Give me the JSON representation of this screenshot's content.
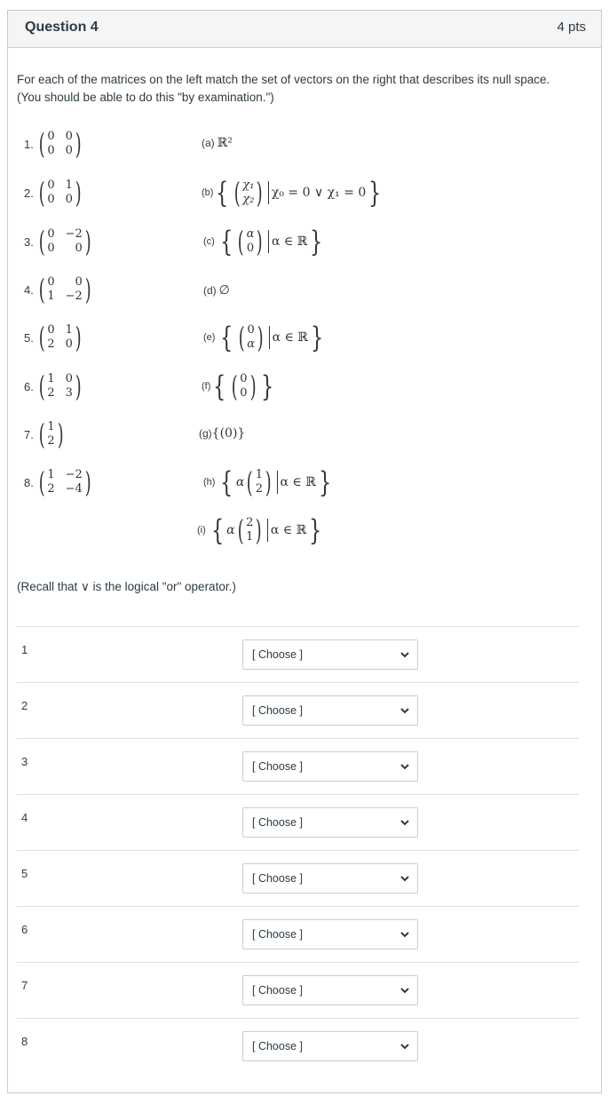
{
  "question": {
    "title": "Question 4",
    "points": "4 pts",
    "intro": "For each of the matrices on the left match the set of vectors on the right that describes its null space. (You should be able to do this \"by examination.\")",
    "recall": "(Recall that ∨ is the logical \"or\" operator.)"
  },
  "matrices": [
    {
      "label": "1.",
      "cells": [
        "0",
        "0",
        "0",
        "0"
      ]
    },
    {
      "label": "2.",
      "cells": [
        "0",
        "1",
        "0",
        "0"
      ]
    },
    {
      "label": "3.",
      "cells": [
        "0",
        "−2",
        "0",
        "0"
      ]
    },
    {
      "label": "4.",
      "cells": [
        "0",
        "0",
        "1",
        "−2"
      ]
    },
    {
      "label": "5.",
      "cells": [
        "0",
        "1",
        "2",
        "0"
      ]
    },
    {
      "label": "6.",
      "cells": [
        "1",
        "0",
        "2",
        "3"
      ]
    },
    {
      "label": "7.",
      "cells": [
        "1",
        "2"
      ]
    },
    {
      "label": "8.",
      "cells": [
        "1",
        "−2",
        "2",
        "−4"
      ]
    }
  ],
  "options": {
    "a": {
      "label": "(a)",
      "text": "ℝ²"
    },
    "b": {
      "label": "(b)",
      "v1": "χ₁",
      "v2": "χ₂",
      "cond": "χ₀ = 0 ∨ χ₁ = 0"
    },
    "c": {
      "label": "(c)",
      "v1": "α",
      "v2": "0",
      "cond": "α ∈ ℝ"
    },
    "d": {
      "label": "(d)",
      "text": "∅"
    },
    "e": {
      "label": "(e)",
      "v1": "0",
      "v2": "α",
      "cond": "α ∈ ℝ"
    },
    "f": {
      "label": "(f)",
      "v1": "0",
      "v2": "0"
    },
    "g": {
      "label": "(g)",
      "text": "{(0)}"
    },
    "h": {
      "label": "(h)",
      "coef": "α",
      "v1": "1",
      "v2": "2",
      "cond": "α ∈ ℝ"
    },
    "i": {
      "label": "(i)",
      "coef": "α",
      "v1": "2",
      "v2": "1",
      "cond": "α ∈ ℝ"
    }
  },
  "answers": [
    {
      "num": "1",
      "selected": "[ Choose ]"
    },
    {
      "num": "2",
      "selected": "[ Choose ]"
    },
    {
      "num": "3",
      "selected": "[ Choose ]"
    },
    {
      "num": "4",
      "selected": "[ Choose ]"
    },
    {
      "num": "5",
      "selected": "[ Choose ]"
    },
    {
      "num": "6",
      "selected": "[ Choose ]"
    },
    {
      "num": "7",
      "selected": "[ Choose ]"
    },
    {
      "num": "8",
      "selected": "[ Choose ]"
    }
  ],
  "icons": {
    "dropdown": "chevron-down-icon"
  }
}
